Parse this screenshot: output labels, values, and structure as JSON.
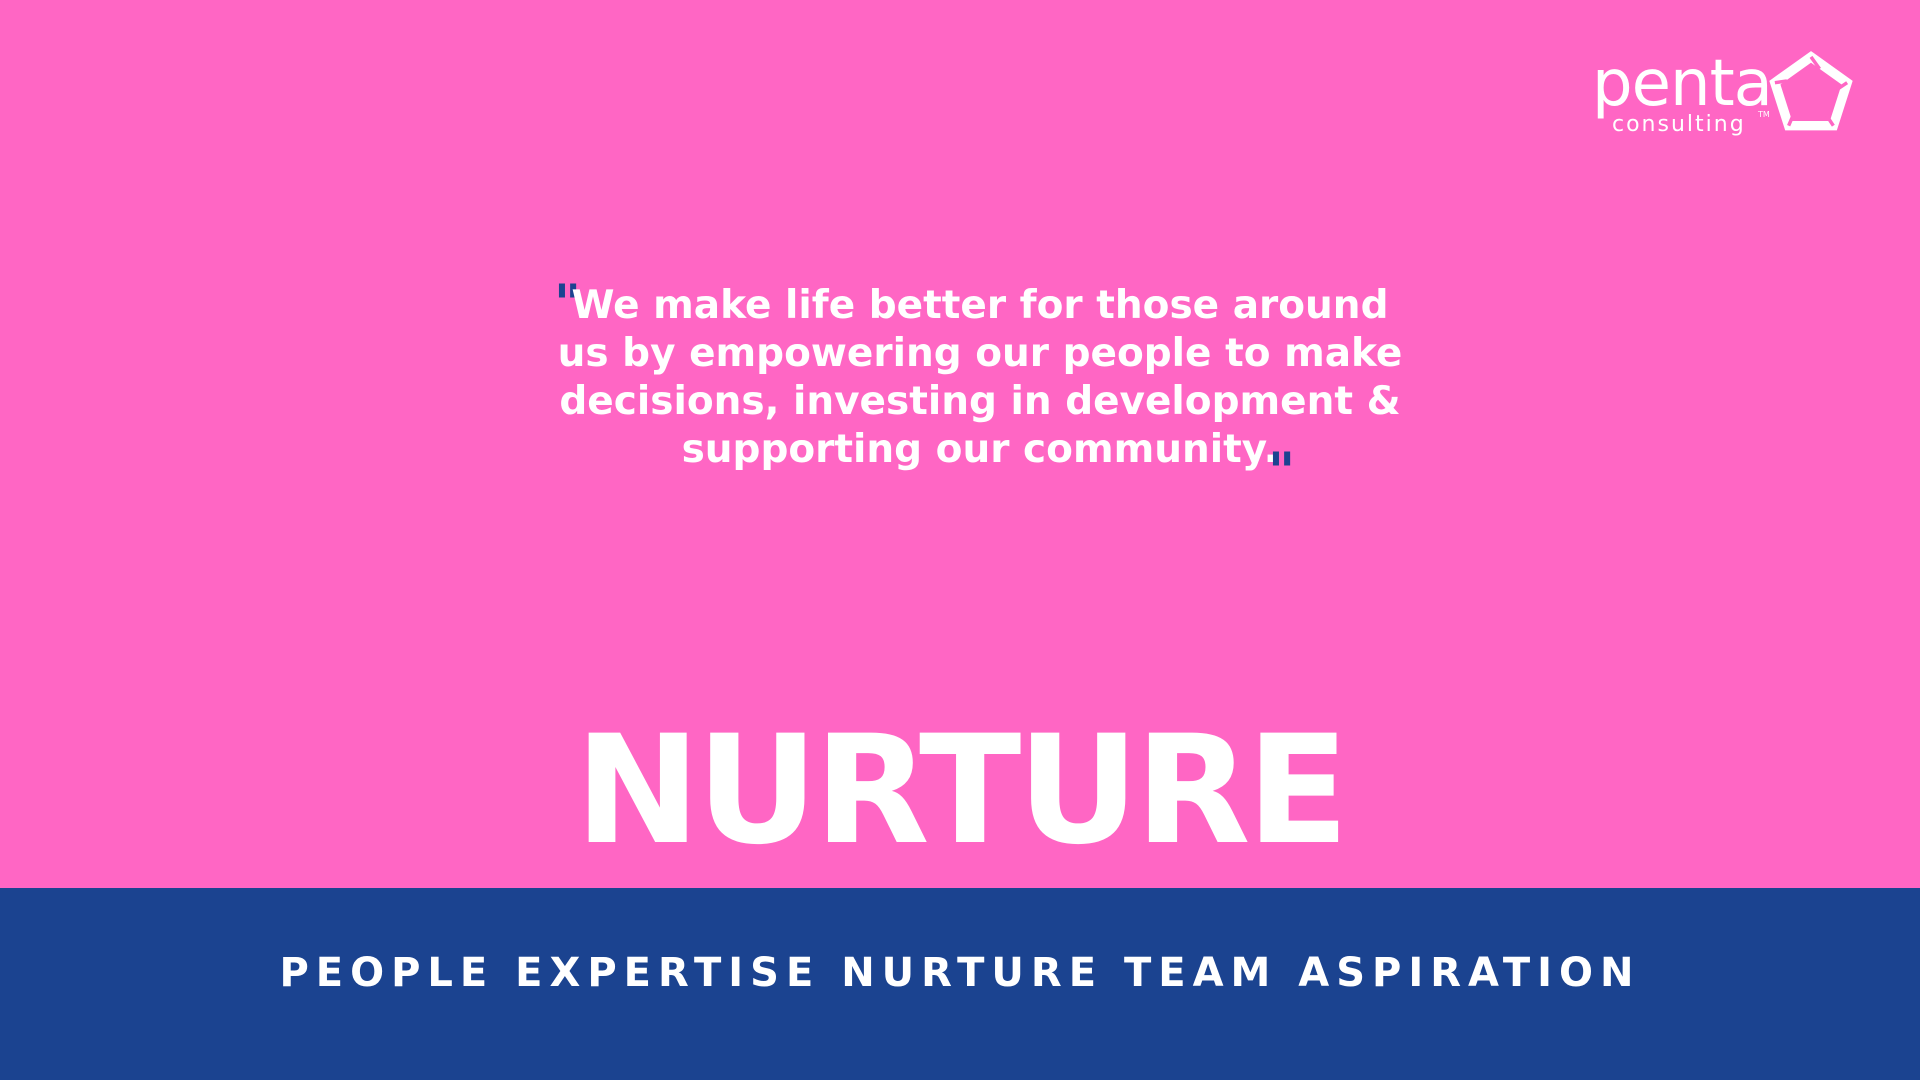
{
  "colors": {
    "background": "#ff66c4",
    "band": "#1b4390",
    "text": "#ffffff",
    "quote_marks": "#1b4390"
  },
  "logo": {
    "wordmark": "penta",
    "subtitle": "consulting",
    "trademark": "TM",
    "icon": "pentagon-logo-icon"
  },
  "quote": {
    "open_mark": "\"",
    "text": "We make life better for those around us by empowering our people to make decisions, investing in development & supporting our community.",
    "close_mark": "\""
  },
  "headline": "NURTURE",
  "values_line": "PEOPLE EXPERTISE NURTURE TEAM ASPIRATION"
}
